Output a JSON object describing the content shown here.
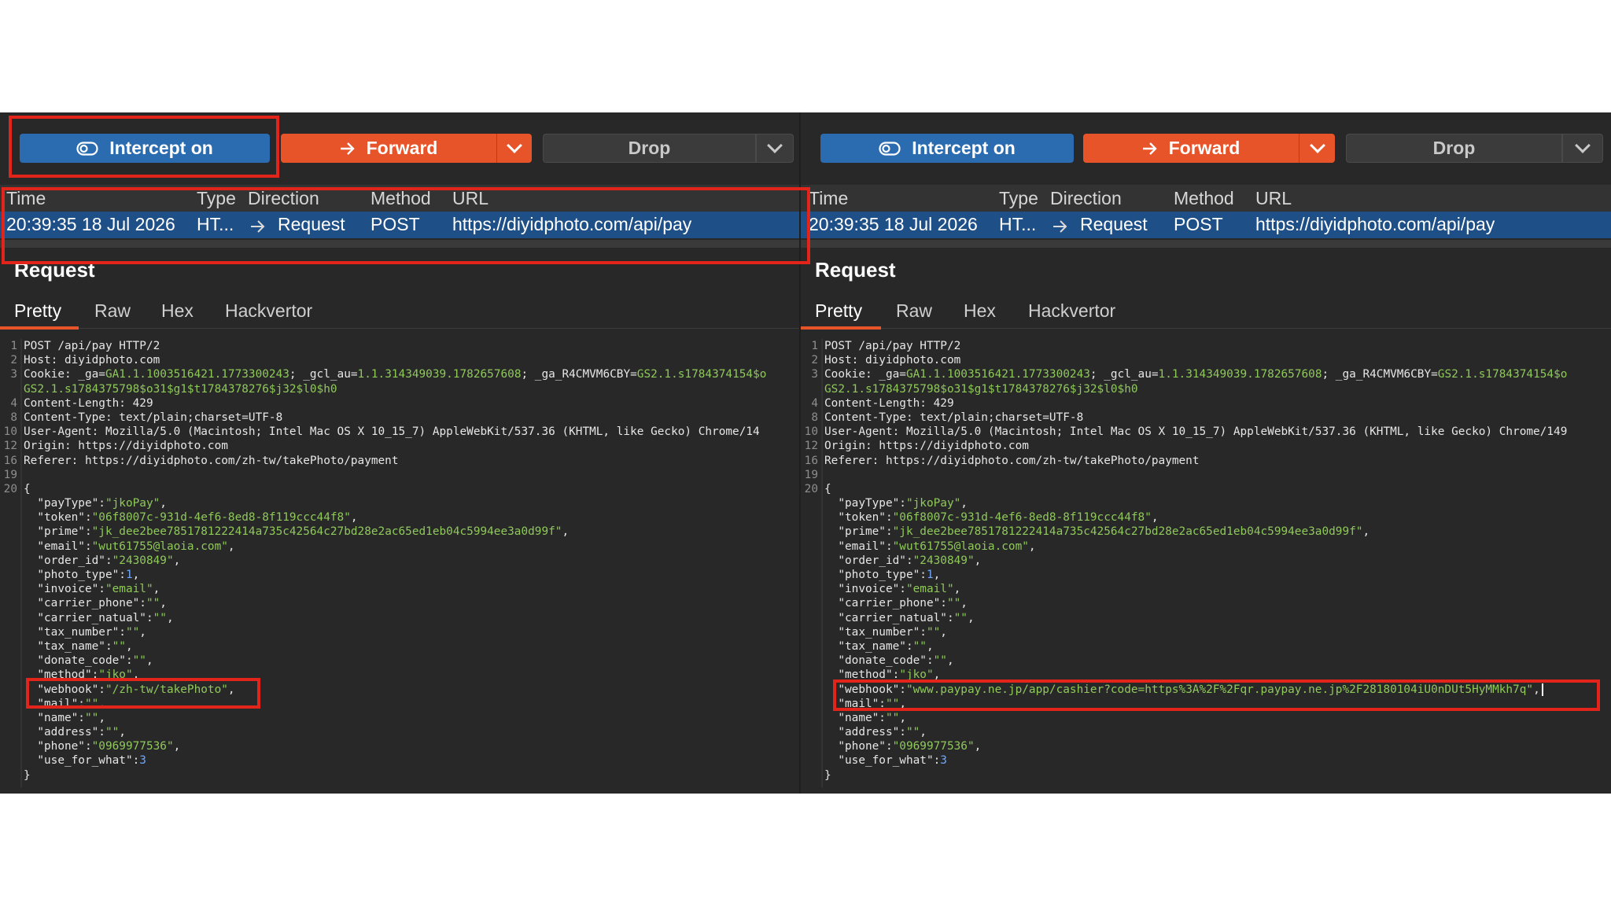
{
  "toolbar": {
    "intercept_label": "Intercept on",
    "forward_label": "Forward",
    "drop_label": "Drop"
  },
  "table": {
    "headers": [
      "Time",
      "Type",
      "Direction",
      "Method",
      "URL"
    ],
    "row": {
      "time": "20:39:35 18 Jul 2026",
      "type": "HT...",
      "direction": "Request",
      "method": "POST",
      "url": "https://diyidphoto.com/api/pay"
    }
  },
  "request": {
    "title": "Request",
    "tabs": [
      "Pretty",
      "Raw",
      "Hex",
      "Hackvertor"
    ],
    "active_tab": "Pretty"
  },
  "code_left": [
    {
      "n": "1",
      "parts": [
        [
          "k",
          "POST /api/pay HTTP/2"
        ]
      ]
    },
    {
      "n": "2",
      "parts": [
        [
          "k",
          "Host: "
        ],
        [
          "k",
          "diyidphoto.com"
        ]
      ]
    },
    {
      "n": "3",
      "parts": [
        [
          "k",
          "Cookie: _ga="
        ],
        [
          "s",
          "GA1.1.1003516421.1773300243"
        ],
        [
          "k",
          "; _gcl_au="
        ],
        [
          "s",
          "1.1.314349039.1782657608"
        ],
        [
          "k",
          "; _ga_R4CMVM6CBY="
        ],
        [
          "s",
          "GS2.1.s1784374154$o"
        ]
      ]
    },
    {
      "n": "",
      "parts": [
        [
          "s",
          "GS2.1.s1784375798$o31$g1$t1784378276$j32$l0$h0"
        ]
      ]
    },
    {
      "n": "4",
      "parts": [
        [
          "k",
          "Content-Length: 429"
        ]
      ]
    },
    {
      "n": "8",
      "parts": [
        [
          "k",
          "Content-Type: text/plain;charset=UTF-8"
        ]
      ]
    },
    {
      "n": "10",
      "parts": [
        [
          "k",
          "User-Agent: Mozilla/5.0 (Macintosh; Intel Mac OS X 10_15_7) AppleWebKit/537.36 (KHTML, like Gecko) Chrome/14"
        ]
      ]
    },
    {
      "n": "12",
      "parts": [
        [
          "k",
          "Origin: https://diyidphoto.com"
        ]
      ]
    },
    {
      "n": "16",
      "parts": [
        [
          "k",
          "Referer: https://diyidphoto.com/zh-tw/takePhoto/payment"
        ]
      ]
    },
    {
      "n": "19",
      "parts": [
        [
          "k",
          ""
        ]
      ]
    },
    {
      "n": "20",
      "parts": [
        [
          "k",
          "{"
        ]
      ]
    },
    {
      "n": "",
      "parts": [
        [
          "k",
          "  \"payType\":"
        ],
        [
          "s",
          "\"jkoPay\""
        ],
        [
          "k",
          ","
        ]
      ]
    },
    {
      "n": "",
      "parts": [
        [
          "k",
          "  \"token\":"
        ],
        [
          "s",
          "\"06f8007c-931d-4ef6-8ed8-8f119ccc44f8\""
        ],
        [
          "k",
          ","
        ]
      ]
    },
    {
      "n": "",
      "parts": [
        [
          "k",
          "  \"prime\":"
        ],
        [
          "s",
          "\"jk_dee2bee7851781222414a735c42564c27bd28e2ac65ed1eb04c5994ee3a0d99f\""
        ],
        [
          "k",
          ","
        ]
      ]
    },
    {
      "n": "",
      "parts": [
        [
          "k",
          "  \"email\":"
        ],
        [
          "s",
          "\"wut61755@laoia.com\""
        ],
        [
          "k",
          ","
        ]
      ]
    },
    {
      "n": "",
      "parts": [
        [
          "k",
          "  \"order_id\":"
        ],
        [
          "s",
          "\"2430849\""
        ],
        [
          "k",
          ","
        ]
      ]
    },
    {
      "n": "",
      "parts": [
        [
          "k",
          "  \"photo_type\":"
        ],
        [
          "n",
          "1"
        ],
        [
          "k",
          ","
        ]
      ]
    },
    {
      "n": "",
      "parts": [
        [
          "k",
          "  \"invoice\":"
        ],
        [
          "s",
          "\"email\""
        ],
        [
          "k",
          ","
        ]
      ]
    },
    {
      "n": "",
      "parts": [
        [
          "k",
          "  \"carrier_phone\":"
        ],
        [
          "s",
          "\"\""
        ],
        [
          "k",
          ","
        ]
      ]
    },
    {
      "n": "",
      "parts": [
        [
          "k",
          "  \"carrier_natual\":"
        ],
        [
          "s",
          "\"\""
        ],
        [
          "k",
          ","
        ]
      ]
    },
    {
      "n": "",
      "parts": [
        [
          "k",
          "  \"tax_number\":"
        ],
        [
          "s",
          "\"\""
        ],
        [
          "k",
          ","
        ]
      ]
    },
    {
      "n": "",
      "parts": [
        [
          "k",
          "  \"tax_name\":"
        ],
        [
          "s",
          "\"\""
        ],
        [
          "k",
          ","
        ]
      ]
    },
    {
      "n": "",
      "parts": [
        [
          "k",
          "  \"donate_code\":"
        ],
        [
          "s",
          "\"\""
        ],
        [
          "k",
          ","
        ]
      ]
    },
    {
      "n": "",
      "parts": [
        [
          "k",
          "  \"method\":"
        ],
        [
          "s",
          "\"jko\""
        ],
        [
          "k",
          ","
        ]
      ]
    },
    {
      "n": "",
      "parts": [
        [
          "k",
          "  \"webhook\":"
        ],
        [
          "s",
          "\"/zh-tw/takePhoto\""
        ],
        [
          "k",
          ","
        ]
      ]
    },
    {
      "n": "",
      "parts": [
        [
          "k",
          "  \"mail\":"
        ],
        [
          "s",
          "\"\""
        ],
        [
          "k",
          ","
        ]
      ]
    },
    {
      "n": "",
      "parts": [
        [
          "k",
          "  \"name\":"
        ],
        [
          "s",
          "\"\""
        ],
        [
          "k",
          ","
        ]
      ]
    },
    {
      "n": "",
      "parts": [
        [
          "k",
          "  \"address\":"
        ],
        [
          "s",
          "\"\""
        ],
        [
          "k",
          ","
        ]
      ]
    },
    {
      "n": "",
      "parts": [
        [
          "k",
          "  \"phone\":"
        ],
        [
          "s",
          "\"0969977536\""
        ],
        [
          "k",
          ","
        ]
      ]
    },
    {
      "n": "",
      "parts": [
        [
          "k",
          "  \"use_for_what\":"
        ],
        [
          "n",
          "3"
        ]
      ]
    },
    {
      "n": "",
      "parts": [
        [
          "k",
          "}"
        ]
      ]
    }
  ],
  "code_right": [
    {
      "n": "1",
      "parts": [
        [
          "k",
          "POST /api/pay HTTP/2"
        ]
      ]
    },
    {
      "n": "2",
      "parts": [
        [
          "k",
          "Host: "
        ],
        [
          "k",
          "diyidphoto.com"
        ]
      ]
    },
    {
      "n": "3",
      "parts": [
        [
          "k",
          "Cookie: _ga="
        ],
        [
          "s",
          "GA1.1.1003516421.1773300243"
        ],
        [
          "k",
          "; _gcl_au="
        ],
        [
          "s",
          "1.1.314349039.1782657608"
        ],
        [
          "k",
          "; _ga_R4CMVM6CBY="
        ],
        [
          "s",
          "GS2.1.s1784374154$o"
        ]
      ]
    },
    {
      "n": "",
      "parts": [
        [
          "s",
          "GS2.1.s1784375798$o31$g1$t1784378276$j32$l0$h0"
        ]
      ]
    },
    {
      "n": "4",
      "parts": [
        [
          "k",
          "Content-Length: 429"
        ]
      ]
    },
    {
      "n": "8",
      "parts": [
        [
          "k",
          "Content-Type: text/plain;charset=UTF-8"
        ]
      ]
    },
    {
      "n": "10",
      "parts": [
        [
          "k",
          "User-Agent: Mozilla/5.0 (Macintosh; Intel Mac OS X 10_15_7) AppleWebKit/537.36 (KHTML, like Gecko) Chrome/149"
        ]
      ]
    },
    {
      "n": "12",
      "parts": [
        [
          "k",
          "Origin: https://diyidphoto.com"
        ]
      ]
    },
    {
      "n": "16",
      "parts": [
        [
          "k",
          "Referer: https://diyidphoto.com/zh-tw/takePhoto/payment"
        ]
      ]
    },
    {
      "n": "19",
      "parts": [
        [
          "k",
          ""
        ]
      ]
    },
    {
      "n": "20",
      "parts": [
        [
          "k",
          "{"
        ]
      ]
    },
    {
      "n": "",
      "parts": [
        [
          "k",
          "  \"payType\":"
        ],
        [
          "s",
          "\"jkoPay\""
        ],
        [
          "k",
          ","
        ]
      ]
    },
    {
      "n": "",
      "parts": [
        [
          "k",
          "  \"token\":"
        ],
        [
          "s",
          "\"06f8007c-931d-4ef6-8ed8-8f119ccc44f8\""
        ],
        [
          "k",
          ","
        ]
      ]
    },
    {
      "n": "",
      "parts": [
        [
          "k",
          "  \"prime\":"
        ],
        [
          "s",
          "\"jk_dee2bee7851781222414a735c42564c27bd28e2ac65ed1eb04c5994ee3a0d99f\""
        ],
        [
          "k",
          ","
        ]
      ]
    },
    {
      "n": "",
      "parts": [
        [
          "k",
          "  \"email\":"
        ],
        [
          "s",
          "\"wut61755@laoia.com\""
        ],
        [
          "k",
          ","
        ]
      ]
    },
    {
      "n": "",
      "parts": [
        [
          "k",
          "  \"order_id\":"
        ],
        [
          "s",
          "\"2430849\""
        ],
        [
          "k",
          ","
        ]
      ]
    },
    {
      "n": "",
      "parts": [
        [
          "k",
          "  \"photo_type\":"
        ],
        [
          "n",
          "1"
        ],
        [
          "k",
          ","
        ]
      ]
    },
    {
      "n": "",
      "parts": [
        [
          "k",
          "  \"invoice\":"
        ],
        [
          "s",
          "\"email\""
        ],
        [
          "k",
          ","
        ]
      ]
    },
    {
      "n": "",
      "parts": [
        [
          "k",
          "  \"carrier_phone\":"
        ],
        [
          "s",
          "\"\""
        ],
        [
          "k",
          ","
        ]
      ]
    },
    {
      "n": "",
      "parts": [
        [
          "k",
          "  \"carrier_natual\":"
        ],
        [
          "s",
          "\"\""
        ],
        [
          "k",
          ","
        ]
      ]
    },
    {
      "n": "",
      "parts": [
        [
          "k",
          "  \"tax_number\":"
        ],
        [
          "s",
          "\"\""
        ],
        [
          "k",
          ","
        ]
      ]
    },
    {
      "n": "",
      "parts": [
        [
          "k",
          "  \"tax_name\":"
        ],
        [
          "s",
          "\"\""
        ],
        [
          "k",
          ","
        ]
      ]
    },
    {
      "n": "",
      "parts": [
        [
          "k",
          "  \"donate_code\":"
        ],
        [
          "s",
          "\"\""
        ],
        [
          "k",
          ","
        ]
      ]
    },
    {
      "n": "",
      "parts": [
        [
          "k",
          "  \"method\":"
        ],
        [
          "s",
          "\"jko\""
        ],
        [
          "k",
          ","
        ]
      ]
    },
    {
      "n": "",
      "parts": [
        [
          "k",
          "  \"webhook\":"
        ],
        [
          "s",
          "\"www.paypay.ne.jp/app/cashier?code=https%3A%2F%2Fqr.paypay.ne.jp%2F28180104iU0nDUt5HyMMkh7q\""
        ],
        [
          "k",
          ","
        ]
      ]
    },
    {
      "n": "",
      "parts": [
        [
          "k",
          "  \"mail\":"
        ],
        [
          "s",
          "\"\""
        ],
        [
          "k",
          ","
        ]
      ]
    },
    {
      "n": "",
      "parts": [
        [
          "k",
          "  \"name\":"
        ],
        [
          "s",
          "\"\""
        ],
        [
          "k",
          ","
        ]
      ]
    },
    {
      "n": "",
      "parts": [
        [
          "k",
          "  \"address\":"
        ],
        [
          "s",
          "\"\""
        ],
        [
          "k",
          ","
        ]
      ]
    },
    {
      "n": "",
      "parts": [
        [
          "k",
          "  \"phone\":"
        ],
        [
          "s",
          "\"0969977536\""
        ],
        [
          "k",
          ","
        ]
      ]
    },
    {
      "n": "",
      "parts": [
        [
          "k",
          "  \"use_for_what\":"
        ],
        [
          "n",
          "3"
        ]
      ]
    },
    {
      "n": "",
      "parts": [
        [
          "k",
          "}"
        ]
      ]
    }
  ],
  "colors": {
    "accent_forward": "#e8542a",
    "accent_intercept": "#2b6cb0",
    "selected_row": "#1e4f86",
    "highlight_box": "#e3241b",
    "json_string": "#8fc95a",
    "json_number": "#6fa8ff"
  },
  "icons": {
    "intercept": "eye-toggle-icon",
    "forward": "arrow-right-icon",
    "dropdown": "chevron-down-icon"
  }
}
